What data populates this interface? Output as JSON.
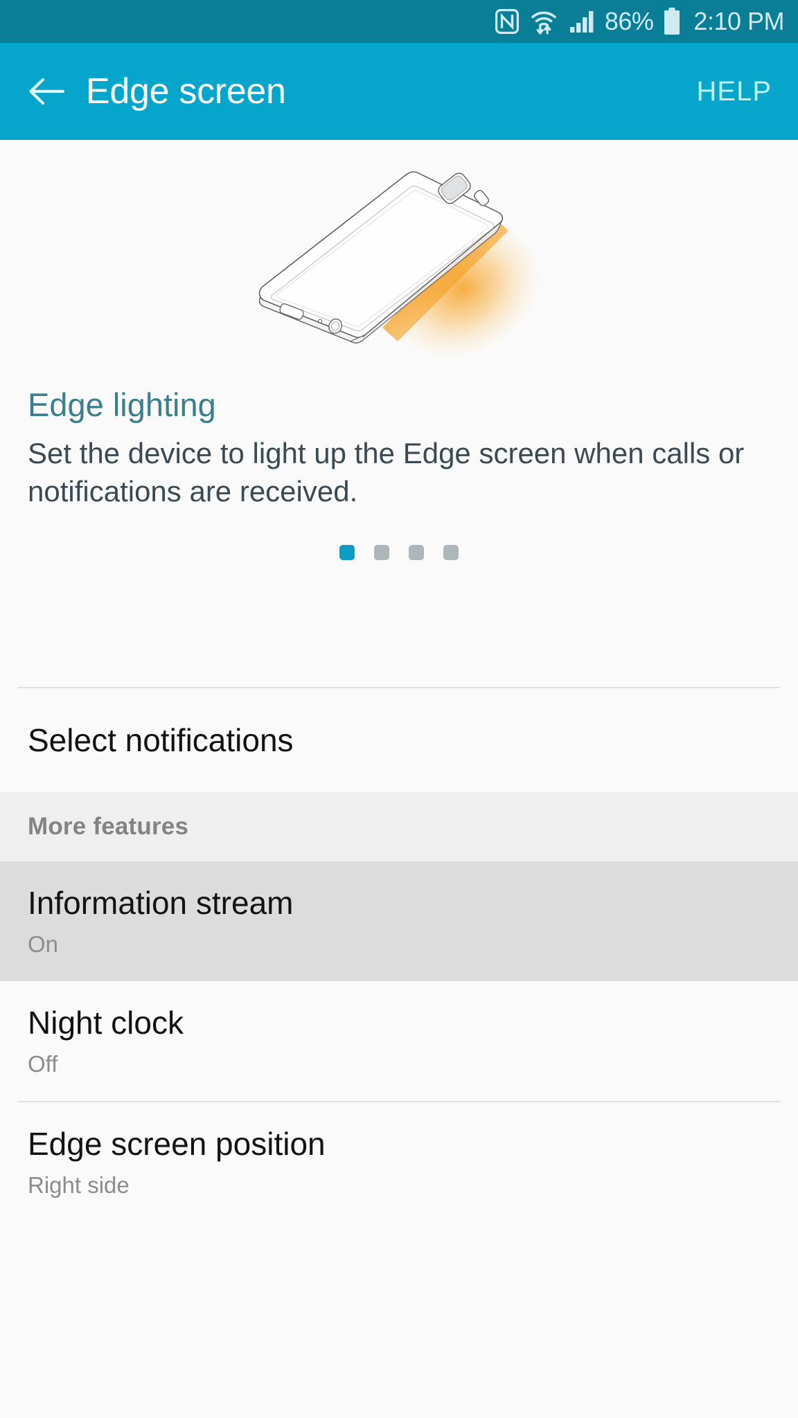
{
  "status_bar": {
    "background": "#0A7E97",
    "icons": [
      "nfc-icon",
      "wifi-icon",
      "signal-icon"
    ],
    "battery_percent": "86%",
    "battery_icon": "battery-icon",
    "time": "2:10 PM"
  },
  "action_bar": {
    "background": "#06A5CB",
    "back_icon": "back-arrow-icon",
    "title": "Edge screen",
    "help_label": "HELP"
  },
  "hero": {
    "illustration": "edge-lighting-phone-illustration",
    "glow_color": "#F59E1F",
    "title": "Edge lighting",
    "title_color": "#3C7F8C",
    "description": "Set the device to light up the Edge screen when calls or notifications are received.",
    "page_indicator": {
      "total": 4,
      "active_index": 0,
      "active_color": "#0C9CC6",
      "inactive_color": "#AFB6BA"
    }
  },
  "list": {
    "select_notifications": {
      "title": "Select notifications"
    },
    "section_header": {
      "label": "More features"
    },
    "items": [
      {
        "title": "Information stream",
        "value": "On",
        "pressed": true
      },
      {
        "title": "Night clock",
        "value": "Off",
        "pressed": false
      },
      {
        "title": "Edge screen position",
        "value": "Right side",
        "pressed": false
      }
    ]
  }
}
